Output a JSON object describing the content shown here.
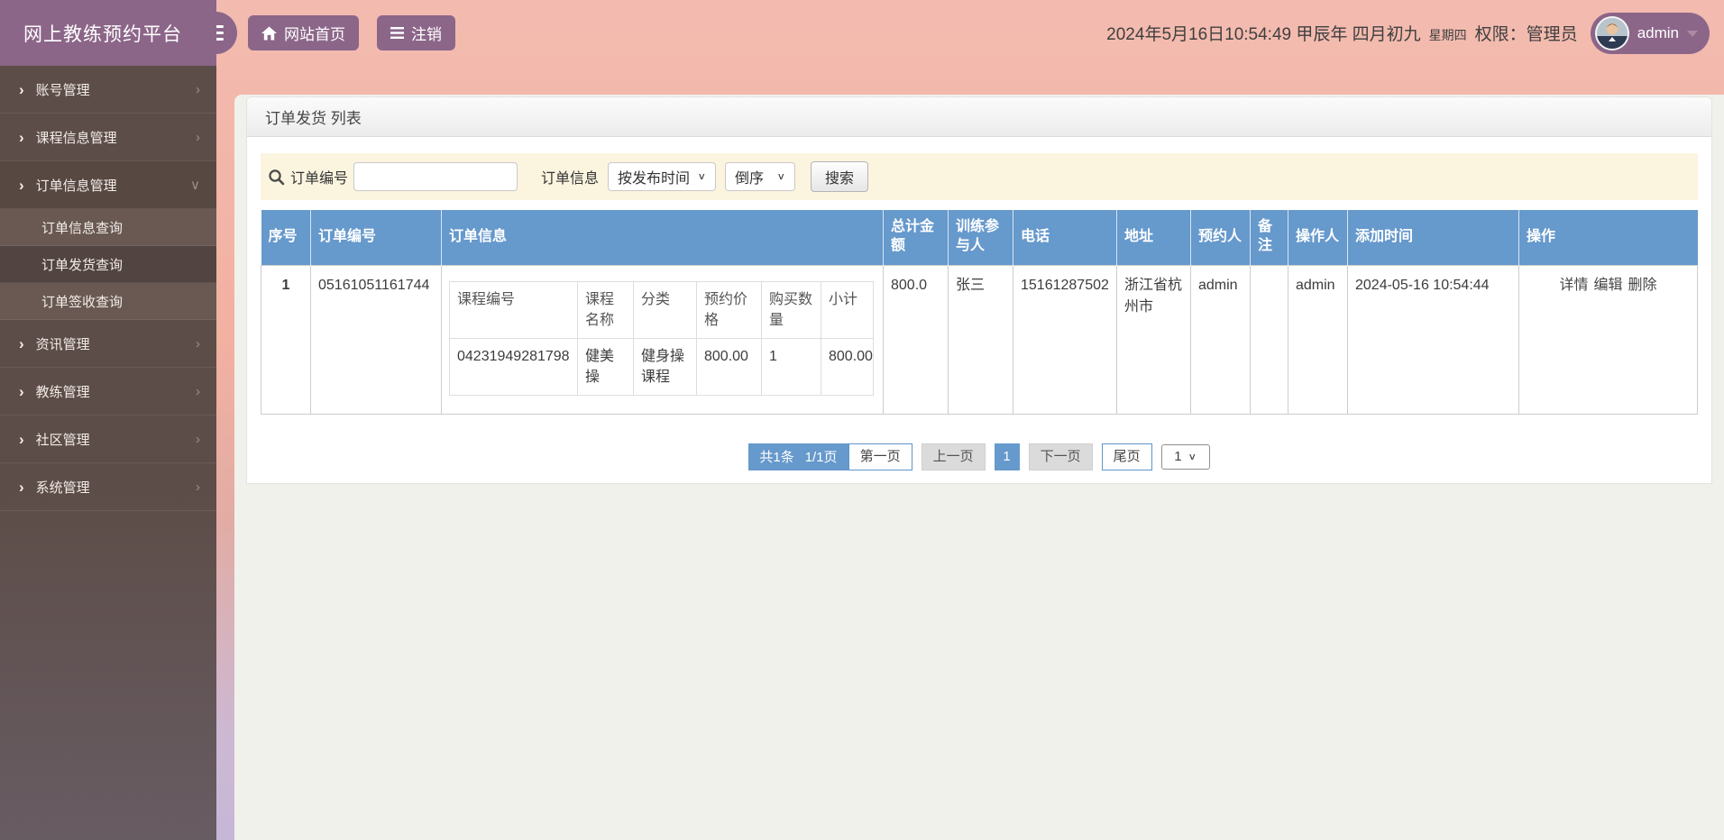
{
  "brand": {
    "title": "网上教练预约平台"
  },
  "header": {
    "nav_home": "网站首页",
    "nav_logout": "注销",
    "datetime": "2024年5月16日10:54:49 甲辰年 四月初九",
    "weekday": "星期四",
    "role_label": "权限：管理员",
    "user": {
      "name": "admin"
    }
  },
  "sidebar": {
    "items": [
      {
        "label": "账号管理"
      },
      {
        "label": "课程信息管理"
      },
      {
        "label": "订单信息管理",
        "children": [
          {
            "label": "订单信息查询"
          },
          {
            "label": "订单发货查询"
          },
          {
            "label": "订单签收查询"
          }
        ]
      },
      {
        "label": "资讯管理"
      },
      {
        "label": "教练管理"
      },
      {
        "label": "社区管理"
      },
      {
        "label": "系统管理"
      }
    ]
  },
  "panel": {
    "title": "订单发货 列表"
  },
  "search": {
    "order_no_label": "订单编号",
    "order_no_value": "",
    "order_info_label": "订单信息",
    "sort_field": "按发布时间",
    "sort_dir": "倒序",
    "submit_label": "搜索"
  },
  "table": {
    "columns": [
      "序号",
      "订单编号",
      "订单信息",
      "总计金额",
      "训练参与人",
      "电话",
      "地址",
      "预约人",
      "备注",
      "操作人",
      "添加时间",
      "操作"
    ],
    "rows": [
      {
        "index": "1",
        "order_no": "05161051161744",
        "order_items": {
          "columns": [
            "课程编号",
            "课程名称",
            "分类",
            "预约价格",
            "购买数量",
            "小计"
          ],
          "rows": [
            [
              "04231949281798",
              "健美操",
              "健身操课程",
              "800.00",
              "1",
              "800.00"
            ]
          ]
        },
        "total": "800.0",
        "participant": "张三",
        "phone": "15161287502",
        "address": "浙江省杭州市",
        "booker": "admin",
        "remark": "",
        "operator": "admin",
        "added_time": "2024-05-16 10:54:44",
        "actions": [
          "详情",
          "编辑",
          "删除"
        ]
      }
    ]
  },
  "pagination": {
    "summary_total": "共1条",
    "summary_page": "1/1页",
    "first": "第一页",
    "prev": "上一页",
    "current": "1",
    "next": "下一页",
    "last": "尾页",
    "page_select": "1"
  },
  "colors": {
    "accent_purple": "#8c6689",
    "table_header_blue": "#6699cc",
    "sidebar_brown": "#5d4d48",
    "search_bar_cream": "#fbf4df",
    "header_pink": "#f2b1a1",
    "background_lavender": "#c6b7d7"
  }
}
